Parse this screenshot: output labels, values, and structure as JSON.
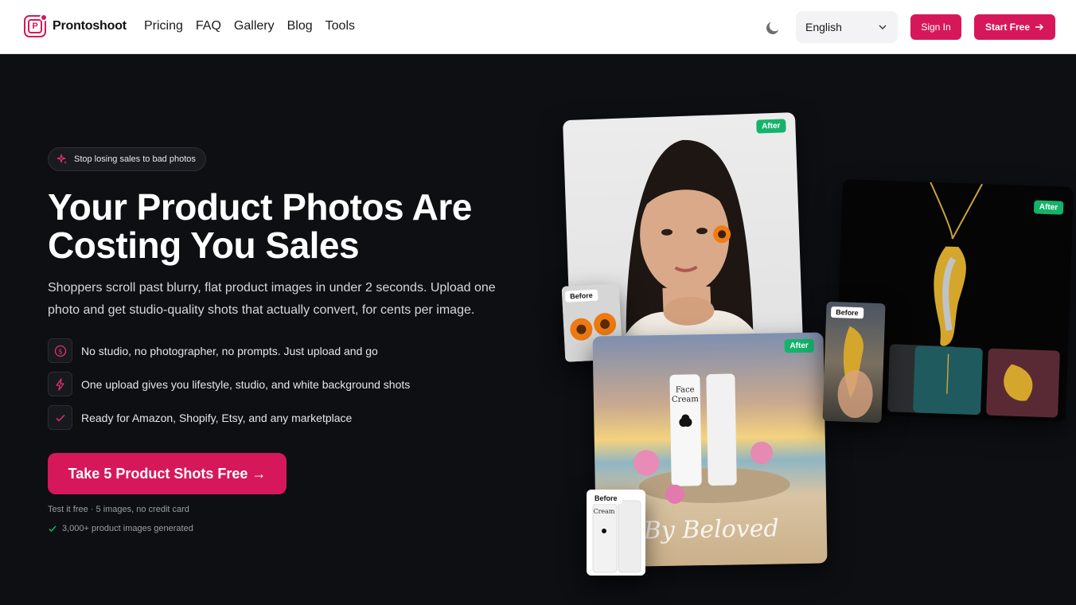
{
  "nav": {
    "logo_text": "Prontoshoot",
    "links": [
      "Pricing",
      "FAQ",
      "Gallery",
      "Blog",
      "Tools"
    ],
    "language": "English",
    "sign_in": "Sign In",
    "start_free": "Start Free"
  },
  "hero": {
    "badge": "Stop losing sales to bad photos",
    "headline": "Your Product Photos Are Costing You Sales",
    "subtext": "Shoppers scroll past blurry, flat product images in under 2 seconds. Upload one photo and get studio-quality shots that actually convert, for cents per image.",
    "features": [
      {
        "icon": "dollar-icon",
        "text": "No studio, no photographer, no prompts. Just upload and go"
      },
      {
        "icon": "bolt-icon",
        "text": "One upload gives you lifestyle, studio, and white background shots"
      },
      {
        "icon": "check-icon",
        "text": "Ready for Amazon, Shopify, Etsy, and any marketplace"
      }
    ],
    "cta": "Take 5 Product Shots Free →",
    "fine_print": "Test it free · 5 images, no credit card",
    "social_proof": "3,000+ product images generated"
  },
  "collage": {
    "after_label": "After",
    "before_label": "Before",
    "cream_tube_label_1": "Face",
    "cream_tube_label_2": "Cream",
    "script_text": "By Beloved",
    "small_cream_label": "Cream"
  },
  "colors": {
    "accent": "#d6185a",
    "after_tag": "#14b36a",
    "background": "#0d0f13"
  }
}
